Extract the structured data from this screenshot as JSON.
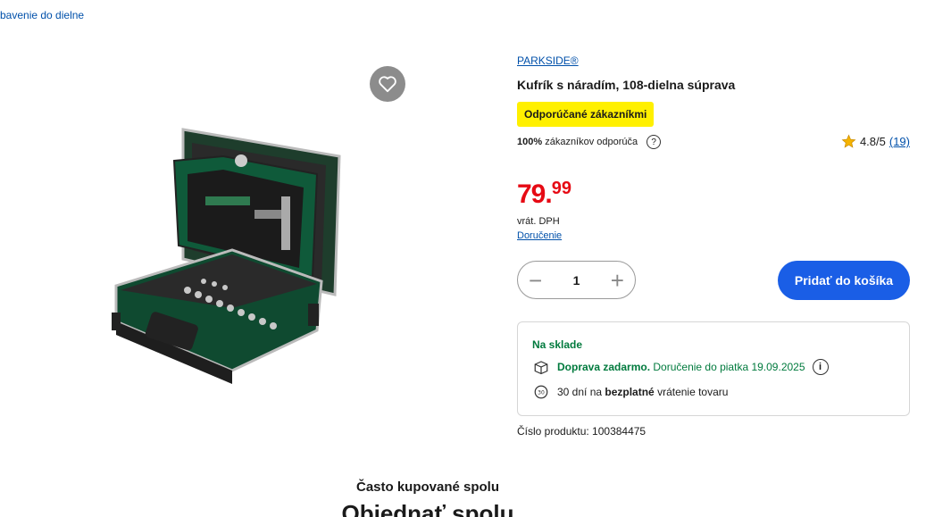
{
  "breadcrumb": "bavenie do dielne",
  "product": {
    "brand": "PARKSIDE®",
    "title": "Kufrík s náradím, 108-dielna súprava",
    "badge": "Odporúčané zákazníkmi",
    "recommend_pct": "100%",
    "recommend_text": "zákazníkov odporúča",
    "rating": "4.8/5",
    "rating_count": "(19)",
    "price_main": "79.",
    "price_cents": "99",
    "vat": "vrát. DPH",
    "delivery_link": "Doručenie",
    "quantity": "1",
    "add_to_cart": "Pridať do košíka",
    "product_number": "Číslo produktu: 100384475"
  },
  "stock": {
    "status": "Na sklade",
    "shipping_bold": "Doprava zadarmo.",
    "shipping_text": " Doručenie do piatka 19.09.2025",
    "return_pre": "30 dní na ",
    "return_bold": "bezplatné",
    "return_post": " vrátenie tovaru"
  },
  "sections": {
    "often_bought": "Často kupované spolu",
    "order_together": "Objednať spolu"
  },
  "colors": {
    "price": "#e60a14",
    "accent": "#1a5ee6",
    "badge": "#fff000",
    "stock_green": "#007a3d"
  }
}
